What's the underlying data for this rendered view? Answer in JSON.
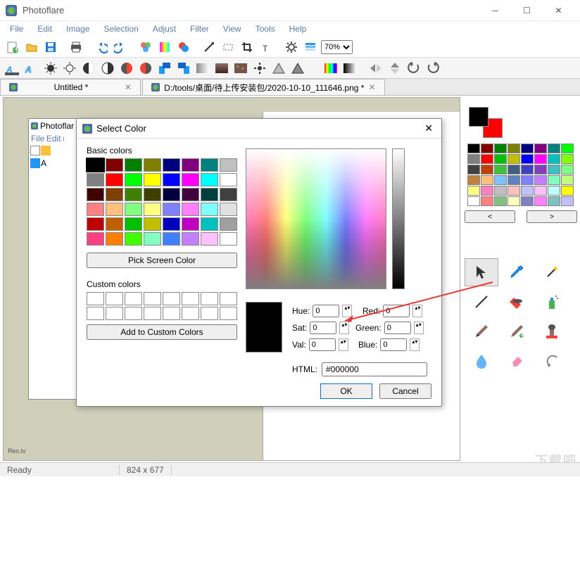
{
  "app": {
    "title": "Photoflare"
  },
  "menu": {
    "file": "File",
    "edit": "Edit",
    "image": "Image",
    "selection": "Selection",
    "adjust": "Adjust",
    "filter": "Filter",
    "view": "View",
    "tools": "Tools",
    "help": "Help"
  },
  "zoom": {
    "value": "70%"
  },
  "tabs": [
    {
      "label": "Untitled *"
    },
    {
      "label": "D:/tools/桌面/待上传安装包/2020-10-10_111646.png *"
    }
  ],
  "status": {
    "ready": "Ready",
    "dims": "824 x 677",
    "res": "Res.tv"
  },
  "palette": {
    "colors": [
      "#000000",
      "#800000",
      "#008000",
      "#808000",
      "#000080",
      "#800080",
      "#008080",
      "#00ff00",
      "#808080",
      "#ff0000",
      "#00c000",
      "#c0c000",
      "#0000ff",
      "#ff00ff",
      "#00c0c0",
      "#80ff00",
      "#404040",
      "#c04000",
      "#40c040",
      "#406080",
      "#4040c0",
      "#8040c0",
      "#40c0c0",
      "#80ff80",
      "#c08040",
      "#ffc080",
      "#80c0ff",
      "#6080c0",
      "#8080ff",
      "#c080ff",
      "#80ffc0",
      "#c0ff80",
      "#ffff80",
      "#ff80c0",
      "#c0c0c0",
      "#ffc0c0",
      "#c0c0ff",
      "#ffc0ff",
      "#c0ffff",
      "#ffff00",
      "#ffffff",
      "#ff8080",
      "#80c080",
      "#ffffc0",
      "#8080c0",
      "#ff80ff",
      "#80c0c0",
      "#c0c0ff"
    ],
    "prev": "<",
    "next": ">"
  },
  "dialog": {
    "title": "Select Color",
    "basic_label": "Basic colors",
    "basic": [
      "#000000",
      "#800000",
      "#008000",
      "#808000",
      "#000080",
      "#800080",
      "#008080",
      "#c0c0c0",
      "#808080",
      "#ff0000",
      "#00ff00",
      "#ffff00",
      "#0000ff",
      "#ff00ff",
      "#00ffff",
      "#ffffff",
      "#400000",
      "#804000",
      "#408000",
      "#404000",
      "#000040",
      "#400040",
      "#004040",
      "#404040",
      "#ff8080",
      "#ffc080",
      "#80ff80",
      "#ffff80",
      "#8080ff",
      "#ff80ff",
      "#80ffff",
      "#e0e0e0",
      "#c00000",
      "#c06000",
      "#00c000",
      "#c0c000",
      "#0000c0",
      "#c000c0",
      "#00c0c0",
      "#a0a0a0",
      "#ff4080",
      "#ff8000",
      "#40ff00",
      "#80ffc0",
      "#4080ff",
      "#c080ff",
      "#ffc0ff",
      "#ffffff"
    ],
    "pick": "Pick Screen Color",
    "custom_label": "Custom colors",
    "add": "Add to Custom Colors",
    "hue_label": "Hue:",
    "sat_label": "Sat:",
    "val_label": "Val:",
    "red_label": "Red:",
    "green_label": "Green:",
    "blue_label": "Blue:",
    "hue": "0",
    "sat": "0",
    "val": "0",
    "red": "0",
    "green": "0",
    "blue": "0",
    "html_label": "HTML:",
    "html": "#000000",
    "ok": "OK",
    "cancel": "Cancel"
  },
  "miniwin": {
    "title": "Photoflar"
  }
}
